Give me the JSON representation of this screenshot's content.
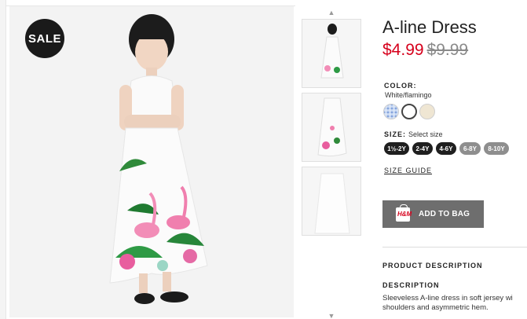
{
  "badge": {
    "sale": "SALE"
  },
  "product": {
    "title": "A-line Dress",
    "price_sale": "$4.99",
    "price_original": "$9.99"
  },
  "color": {
    "label": "COLOR:",
    "value": "White/flamingo",
    "swatches": [
      "blue-pattern",
      "white",
      "beige"
    ]
  },
  "size": {
    "label": "SIZE:",
    "hint": "Select size",
    "options": [
      "1½-2Y",
      "2-4Y",
      "4-6Y",
      "6-8Y",
      "8-10Y"
    ],
    "available": [
      true,
      true,
      true,
      false,
      false
    ],
    "guide_label": "SIZE GUIDE"
  },
  "cart": {
    "add_label": "ADD TO BAG",
    "logo_text": "H&M"
  },
  "description": {
    "section_title": "PRODUCT DESCRIPTION",
    "heading": "DESCRIPTION",
    "line1": "Sleeveless A-line dress in soft jersey wi",
    "line2": "shoulders and asymmetric hem."
  },
  "colors": {
    "sale_red": "#d6001c",
    "button_gray": "#6e6e6e",
    "size_dark": "#1f1f1f",
    "size_unavailable": "#8e8e8e"
  }
}
